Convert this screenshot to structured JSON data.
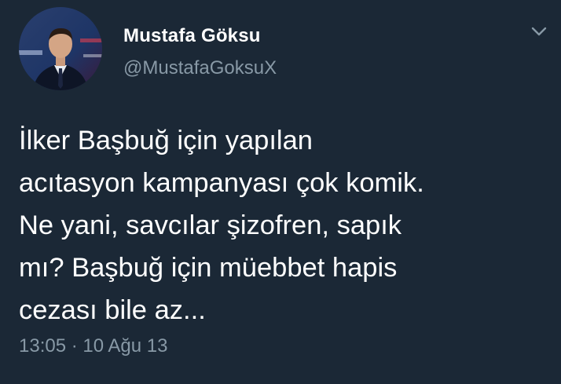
{
  "colors": {
    "background": "#1b2836",
    "primary_text": "#ffffff",
    "secondary_text": "#8899a6"
  },
  "user": {
    "display_name": "Mustafa Göksu",
    "handle": "@MustafaGoksuX",
    "avatar_icon": "profile-photo"
  },
  "tweet": {
    "text_lines": [
      "İlker Başbuğ için yapılan",
      "acıtasyon kampanyası çok komik.",
      "Ne yani, savcılar şizofren, sapık",
      "mı? Başbuğ için müebbet hapis",
      "cezası bile az..."
    ],
    "timestamp": "13:05 · 10 Ağu 13"
  },
  "menu": {
    "icon": "chevron-down-icon"
  }
}
